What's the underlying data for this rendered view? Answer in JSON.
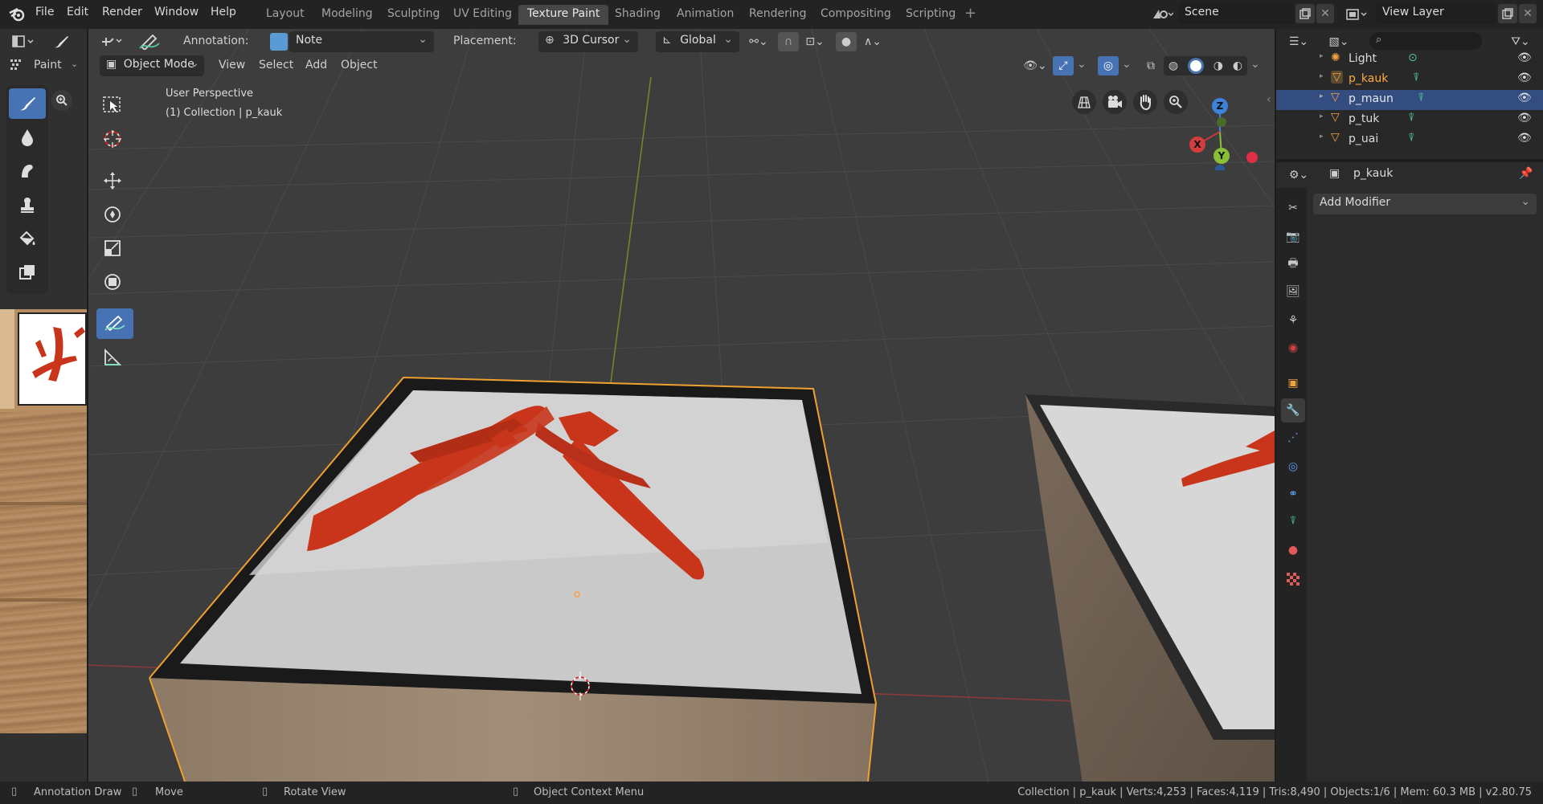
{
  "menu": {
    "file": "File",
    "edit": "Edit",
    "render": "Render",
    "window": "Window",
    "help": "Help"
  },
  "workspaces": [
    "Layout",
    "Modeling",
    "Sculpting",
    "UV Editing",
    "Texture Paint",
    "Shading",
    "Animation",
    "Rendering",
    "Compositing",
    "Scripting"
  ],
  "active_workspace": "Texture Paint",
  "scene": {
    "label": "Scene"
  },
  "view_layer": {
    "label": "View Layer"
  },
  "paint_header": {
    "mode": "Paint"
  },
  "tool_header": {
    "annotation_label": "Annotation:",
    "annotation_value": "Note",
    "placement_label": "Placement:",
    "placement_value": "3D Cursor",
    "orientation": "Global"
  },
  "viewport_header": {
    "mode": "Object Mode",
    "view": "View",
    "select": "Select",
    "add": "Add",
    "object": "Object"
  },
  "viewport_info": {
    "perspective": "User Perspective",
    "collection": "(1) Collection | p_kauk"
  },
  "gizmo": {
    "x": "X",
    "y": "Y",
    "z": "Z"
  },
  "outliner": {
    "items": [
      {
        "name": "Light",
        "selected": false,
        "active": false
      },
      {
        "name": "p_kauk",
        "selected": false,
        "active": true
      },
      {
        "name": "p_maun",
        "selected": true,
        "active": false
      },
      {
        "name": "p_tuk",
        "selected": false,
        "active": false
      },
      {
        "name": "p_uai",
        "selected": false,
        "active": false
      }
    ]
  },
  "properties": {
    "object_name": "p_kauk",
    "add_modifier": "Add Modifier"
  },
  "statusbar": {
    "annotation_draw": "Annotation Draw",
    "move": "Move",
    "rotate_view": "Rotate View",
    "context_menu": "Object Context Menu",
    "stats": "Collection | p_kauk | Verts:4,253 | Faces:4,119 | Tris:8,490 | Objects:1/6 | Mem: 60.3 MB | v2.80.75"
  },
  "colors": {
    "accent": "#4772b3",
    "selected_row": "#334d80",
    "active_object": "#ffaa40",
    "seal_red": "#c8351b"
  }
}
